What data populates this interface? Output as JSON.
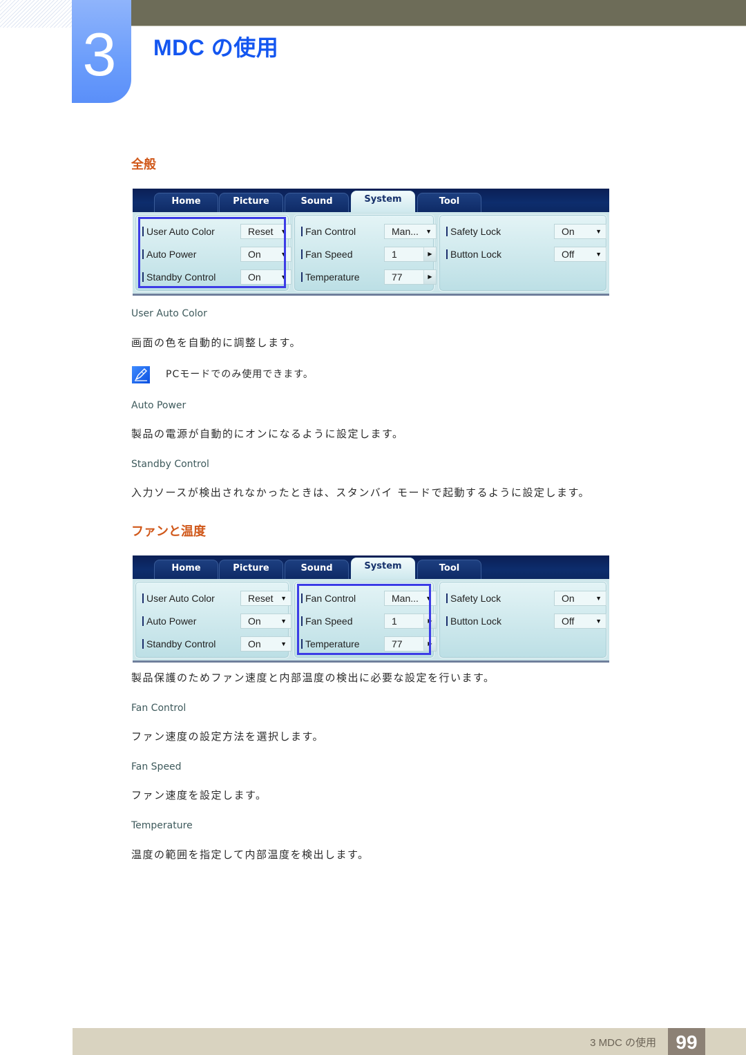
{
  "header": {
    "chapter_number": "3",
    "chapter_title": "MDC の使用"
  },
  "sections": [
    {
      "title": "全般",
      "panel": {
        "tabs": [
          "Home",
          "Picture",
          "Sound",
          "System",
          "Tool"
        ],
        "active_tab": "System",
        "highlighted_group": "left",
        "left": [
          {
            "label": "User Auto Color",
            "value": "Reset",
            "control": "dropdown"
          },
          {
            "label": "Auto Power",
            "value": "On",
            "control": "dropdown"
          },
          {
            "label": "Standby Control",
            "value": "On",
            "control": "dropdown"
          }
        ],
        "middle": [
          {
            "label": "Fan Control",
            "value": "Man...",
            "control": "dropdown"
          },
          {
            "label": "Fan Speed",
            "value": "1",
            "control": "spinner"
          },
          {
            "label": "Temperature",
            "value": "77",
            "control": "spinner"
          }
        ],
        "right": [
          {
            "label": "Safety Lock",
            "value": "On",
            "control": "dropdown"
          },
          {
            "label": "Button Lock",
            "value": "Off",
            "control": "dropdown"
          }
        ]
      },
      "items": [
        {
          "heading": "User Auto Color",
          "text": "画面の色を自動的に調整します。",
          "note": "PCモードでのみ使用できます。"
        },
        {
          "heading": "Auto Power",
          "text": "製品の電源が自動的にオンになるように設定します。"
        },
        {
          "heading": "Standby Control",
          "text": "入力ソースが検出されなかったときは、スタンバイ モードで起動するように設定します。"
        }
      ]
    },
    {
      "title": "ファンと温度",
      "panel": {
        "tabs": [
          "Home",
          "Picture",
          "Sound",
          "System",
          "Tool"
        ],
        "active_tab": "System",
        "highlighted_group": "middle",
        "left": [
          {
            "label": "User Auto Color",
            "value": "Reset",
            "control": "dropdown"
          },
          {
            "label": "Auto Power",
            "value": "On",
            "control": "dropdown"
          },
          {
            "label": "Standby Control",
            "value": "On",
            "control": "dropdown"
          }
        ],
        "middle": [
          {
            "label": "Fan Control",
            "value": "Man...",
            "control": "dropdown"
          },
          {
            "label": "Fan Speed",
            "value": "1",
            "control": "spinner"
          },
          {
            "label": "Temperature",
            "value": "77",
            "control": "spinner"
          }
        ],
        "right": [
          {
            "label": "Safety Lock",
            "value": "On",
            "control": "dropdown"
          },
          {
            "label": "Button Lock",
            "value": "Off",
            "control": "dropdown"
          }
        ]
      },
      "intro": "製品保護のためファン速度と内部温度の検出に必要な設定を行います。",
      "items": [
        {
          "heading": "Fan Control",
          "text": "ファン速度の設定方法を選択します。"
        },
        {
          "heading": "Fan Speed",
          "text": "ファン速度を設定します。"
        },
        {
          "heading": "Temperature",
          "text": "温度の範囲を指定して内部温度を検出します。"
        }
      ]
    }
  ],
  "icons": {
    "note": "note-pencil-icon",
    "dropdown": "▼",
    "spinner": "▶"
  },
  "footer": {
    "chapter_label": "3 MDC の使用",
    "page_number": "99"
  }
}
